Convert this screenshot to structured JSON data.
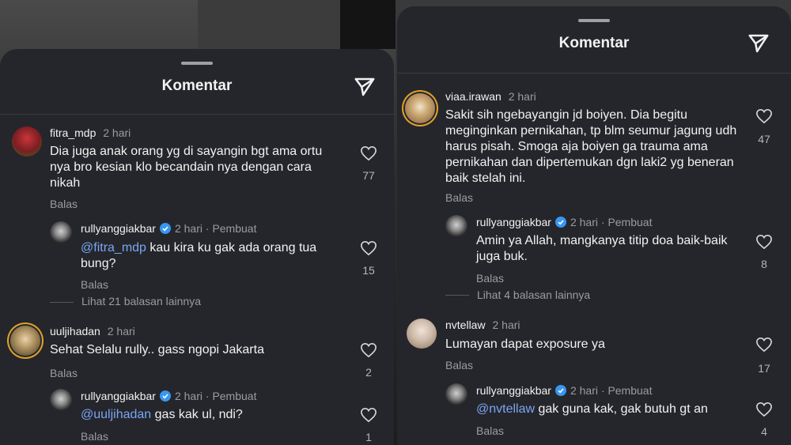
{
  "left": {
    "title": "Komentar",
    "comments": [
      {
        "user": "fitra_mdp",
        "time": "2 hari",
        "text": "Dia juga anak orang yg di sayangin bgt ama ortu nya bro kesian klo becandain nya dengan cara nikah",
        "likes": "77",
        "reply_label": "Balas",
        "reply": {
          "user": "rullyanggiakbar",
          "time": "2 hari",
          "creator": "Pembuat",
          "mention": "@fitra_mdp",
          "text": " kau kira ku gak ada orang tua bung?",
          "likes": "15",
          "reply_label": "Balas"
        },
        "more": "Lihat 21 balasan lainnya"
      },
      {
        "user": "uuljihadan",
        "time": "2 hari",
        "text": "Sehat Selalu rully.. gass ngopi Jakarta",
        "likes": "2",
        "reply_label": "Balas",
        "reply": {
          "user": "rullyanggiakbar",
          "time": "2 hari",
          "creator": "Pembuat",
          "mention": "@uuljihadan",
          "text": " gas kak ul, ndi?",
          "likes": "1",
          "reply_label": "Balas"
        }
      }
    ]
  },
  "right": {
    "title": "Komentar",
    "comments": [
      {
        "user": "viaa.irawan",
        "time": "2 hari",
        "text": "Sakit sih ngebayangin jd boiyen. Dia begitu meginginkan pernikahan, tp blm seumur jagung udh harus pisah. Smoga aja boiyen ga trauma ama pernikahan dan dipertemukan dgn laki2 yg beneran baik stelah ini.",
        "likes": "47",
        "reply_label": "Balas",
        "reply": {
          "user": "rullyanggiakbar",
          "time": "2 hari",
          "creator": "Pembuat",
          "mention": "",
          "text": "Amin ya Allah, mangkanya titip doa baik-baik juga buk.",
          "likes": "8",
          "reply_label": "Balas"
        },
        "more": "Lihat 4 balasan lainnya"
      },
      {
        "user": "nvtellaw",
        "time": "2 hari",
        "text": "Lumayan dapat exposure ya",
        "likes": "17",
        "reply_label": "Balas",
        "reply": {
          "user": "rullyanggiakbar",
          "time": "2 hari",
          "creator": "Pembuat",
          "mention": "@nvtellaw",
          "text": " gak guna kak, gak butuh gt an",
          "likes": "4",
          "reply_label": "Balas"
        }
      }
    ]
  },
  "icons": {
    "share": "send-icon",
    "like": "heart-icon",
    "verified": "verified-badge-icon"
  },
  "colors": {
    "sheet": "#25262b",
    "text": "#f2f2f2",
    "muted": "#9b9ba0",
    "mention": "#7aa6f4",
    "verified": "#3897f0",
    "story_ring": "#e1a128"
  }
}
